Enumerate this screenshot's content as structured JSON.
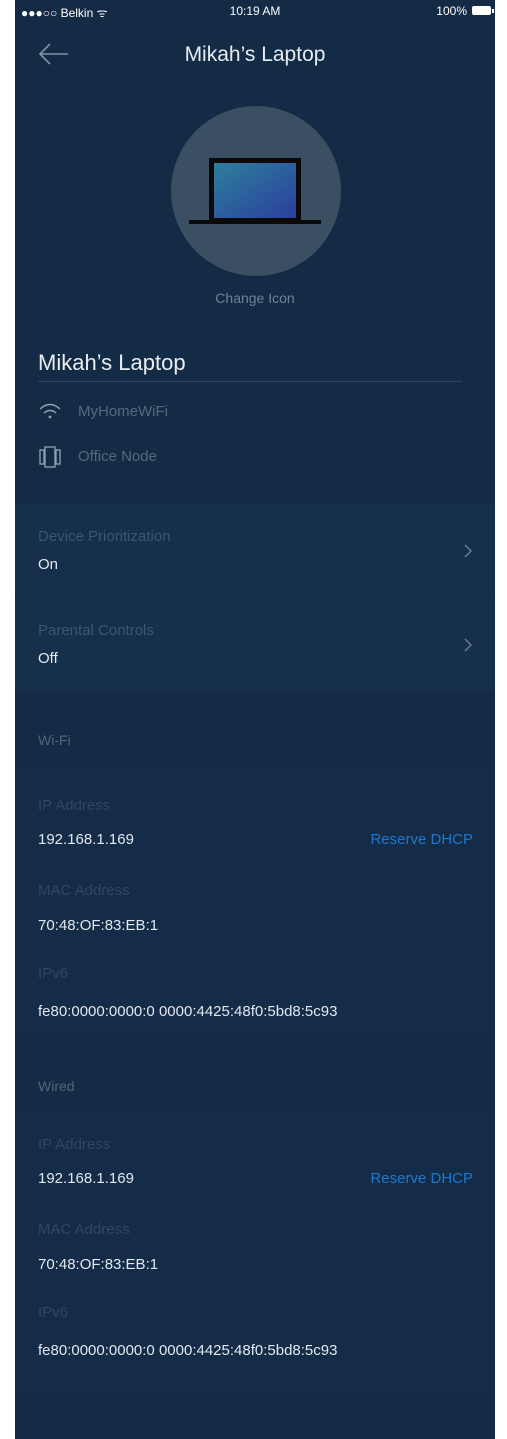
{
  "status_bar": {
    "carrier": "●●●○○ Belkin ᯤ",
    "time": "10:19 AM",
    "battery": "100%"
  },
  "header": {
    "title": "Mikah’s Laptop"
  },
  "device": {
    "change_icon_label": "Change Icon",
    "name": "Mikah’s Laptop",
    "network": "MyHomeWiFi",
    "node": "Office Node"
  },
  "settings": [
    {
      "title": "Device Prioritization",
      "value": "On"
    },
    {
      "title": "Parental Controls",
      "value": "Off"
    }
  ],
  "wifi": {
    "section_title": "Wi-Fi",
    "ip_label": "IP Address",
    "ip_value": "192.168.1.169",
    "reserve_label": "Reserve DHCP",
    "mac_label": "MAC Address",
    "mac_value": "70:48:OF:83:EB:1",
    "ipv6_label": "IPv6",
    "ipv6_value": "fe80:0000:0000:0 0000:4425:48f0:5bd8:5c93"
  },
  "wired": {
    "section_title": "Wired",
    "ip_label": "IP Address",
    "ip_value": "192.168.1.169",
    "reserve_label": "Reserve DHCP",
    "mac_label": "MAC Address",
    "mac_value": "70:48:OF:83:EB:1",
    "ipv6_label": "IPv6",
    "ipv6_value": "fe80:0000:0000:0 0000:4425:48f0:5bd8:5c93"
  },
  "icons": {
    "back": "back-arrow-icon",
    "device": "laptop-icon",
    "network": "wifi-icon",
    "node": "node-icon",
    "chevron": "chevron-right-icon"
  },
  "colors": {
    "background": "#132b45",
    "panel": "#162f4a",
    "accent": "#1c79cf"
  }
}
